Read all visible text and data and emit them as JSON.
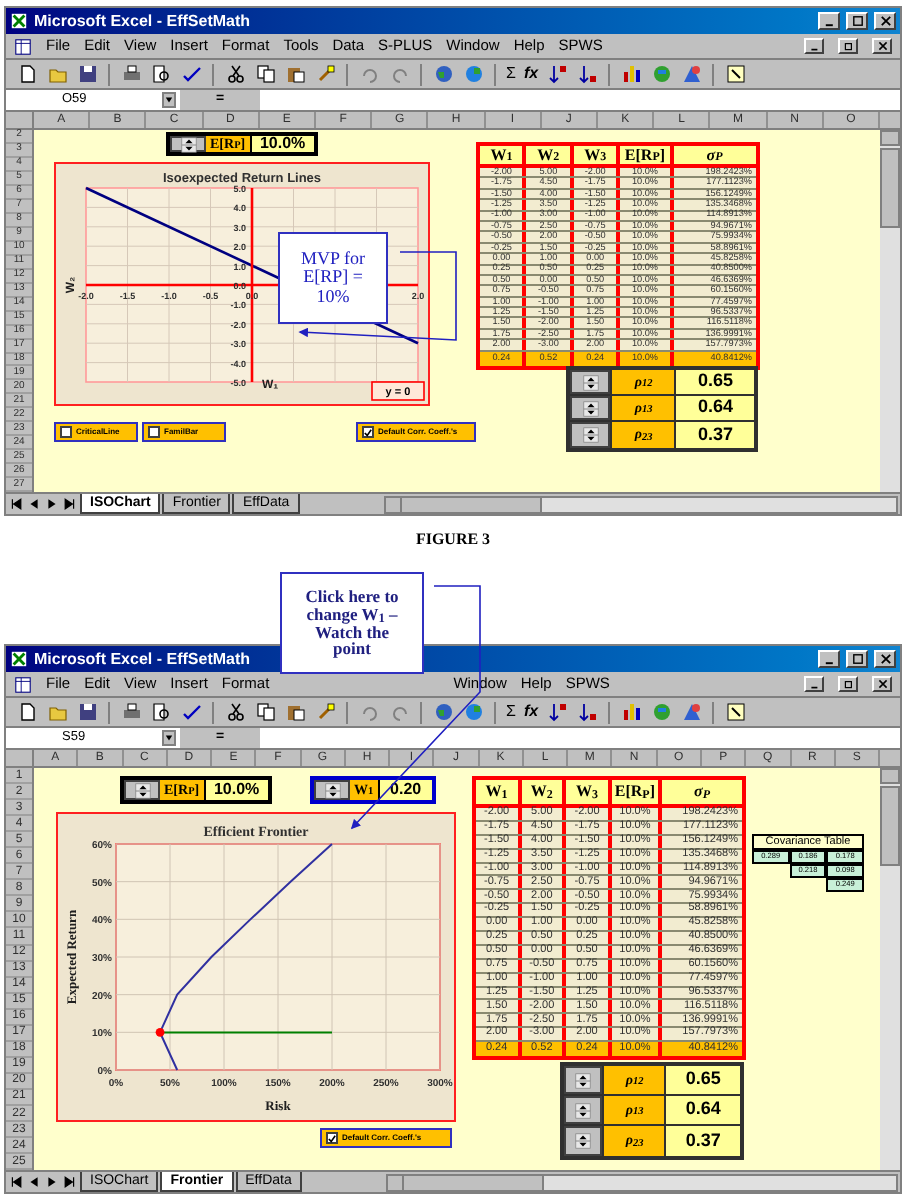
{
  "figures": [
    {
      "window": {
        "title": "Microsoft Excel - EffSetMath"
      },
      "menu": [
        "File",
        "Edit",
        "View",
        "Insert",
        "Format",
        "Tools",
        "Data",
        "S-PLUS",
        "Window",
        "Help",
        "SPWS"
      ],
      "toolbar": {
        "sum_glyph": "Σ",
        "function_glyph": "fx"
      },
      "name_box": "O59",
      "formula_sign": "=",
      "columns": [
        "A",
        "B",
        "C",
        "D",
        "E",
        "F",
        "G",
        "H",
        "I",
        "J",
        "K",
        "L",
        "M",
        "N",
        "O"
      ],
      "rows": [
        "2",
        "3",
        "4",
        "5",
        "6",
        "7",
        "8",
        "9",
        "10",
        "11",
        "12",
        "13",
        "14",
        "15",
        "16",
        "17",
        "18",
        "19",
        "20",
        "21",
        "22",
        "23",
        "24",
        "25",
        "26",
        "27"
      ],
      "spinners": [
        {
          "label": "E[R$_{P}$]",
          "value": "10.0%",
          "color": "#000000"
        }
      ],
      "chart": {
        "chart_data": {
          "type": "line",
          "title": "Isoexpected Return Lines",
          "xlabel": "W₁",
          "ylabel": "W₂",
          "x": [
            -2,
            0,
            0,
            2
          ],
          "xlim": [
            -2,
            2
          ],
          "ylim": [
            -5,
            5
          ],
          "grid": true,
          "series": [
            {
              "color": "#000080",
              "values": [
                5,
                null,
                null,
                -3
              ]
            },
            {
              "name": "y = 0",
              "color": "#ff0000",
              "values": [
                0,
                null,
                null,
                0
              ]
            },
            {
              "color": "#ff0000",
              "values": [
                null,
                5,
                -5,
                null
              ]
            }
          ],
          "xticks": [
            {
              "value": -2,
              "label": "-2.0"
            },
            {
              "value": -1.5,
              "label": "-1.5"
            },
            {
              "value": -1,
              "label": "-1.0"
            },
            {
              "value": -0.5,
              "label": "-0.5"
            },
            {
              "value": 0,
              "label": "0.0"
            },
            {
              "value": 2,
              "label": "2.0"
            }
          ],
          "yticks": [
            {
              "value": 5,
              "label": "5.0"
            },
            {
              "value": 4,
              "label": "4.0"
            },
            {
              "value": 3,
              "label": "3.0"
            },
            {
              "value": 2,
              "label": "2.0"
            },
            {
              "value": 1,
              "label": "1.0"
            },
            {
              "value": 0,
              "label": "0.0"
            },
            {
              "value": -1,
              "label": "-1.0"
            },
            {
              "value": -2,
              "label": "-2.0"
            },
            {
              "value": -3,
              "label": "-3.0"
            },
            {
              "value": -4,
              "label": "-4.0"
            },
            {
              "value": -5,
              "label": "-5.0"
            }
          ]
        }
      },
      "checkboxes": [
        {
          "label": "CriticalLine",
          "checked": false
        },
        {
          "label": "FamilBar",
          "checked": false
        },
        {
          "label": "Default Corr. Coeff.'s",
          "checked": true
        }
      ],
      "table": {
        "columns": [
          "W$_{1}$",
          "W$_{2}$",
          "W$_{3}$",
          "E[R$_{P}$]",
          "σ$_{P}$"
        ],
        "rows": [
          {
            "kind": "data",
            "cells": [
              "-2.00",
              "5.00",
              "-2.00",
              "10.0%",
              "198.2423%"
            ]
          },
          {
            "kind": "data",
            "cells": [
              "-1.75",
              "4.50",
              "-1.75",
              "10.0%",
              "177.1123%"
            ]
          },
          {
            "kind": "data",
            "cells": [
              "-1.50",
              "4.00",
              "-1.50",
              "10.0%",
              "156.1249%"
            ]
          },
          {
            "kind": "data",
            "cells": [
              "-1.25",
              "3.50",
              "-1.25",
              "10.0%",
              "135.3468%"
            ]
          },
          {
            "kind": "data",
            "cells": [
              "-1.00",
              "3.00",
              "-1.00",
              "10.0%",
              "114.8913%"
            ]
          },
          {
            "kind": "data",
            "cells": [
              "-0.75",
              "2.50",
              "-0.75",
              "10.0%",
              "94.9671%"
            ]
          },
          {
            "kind": "data",
            "cells": [
              "-0.50",
              "2.00",
              "-0.50",
              "10.0%",
              "75.9934%"
            ]
          },
          {
            "kind": "data",
            "cells": [
              "-0.25",
              "1.50",
              "-0.25",
              "10.0%",
              "58.8961%"
            ]
          },
          {
            "kind": "data",
            "cells": [
              "0.00",
              "1.00",
              "0.00",
              "10.0%",
              "45.8258%"
            ]
          },
          {
            "kind": "data",
            "cells": [
              "0.25",
              "0.50",
              "0.25",
              "10.0%",
              "40.8500%"
            ]
          },
          {
            "kind": "data",
            "cells": [
              "0.50",
              "0.00",
              "0.50",
              "10.0%",
              "46.6369%"
            ]
          },
          {
            "kind": "data",
            "cells": [
              "0.75",
              "-0.50",
              "0.75",
              "10.0%",
              "60.1560%"
            ]
          },
          {
            "kind": "data",
            "cells": [
              "1.00",
              "-1.00",
              "1.00",
              "10.0%",
              "77.4597%"
            ]
          },
          {
            "kind": "data",
            "cells": [
              "1.25",
              "-1.50",
              "1.25",
              "10.0%",
              "96.5337%"
            ]
          },
          {
            "kind": "data",
            "cells": [
              "1.50",
              "-2.00",
              "1.50",
              "10.0%",
              "116.5118%"
            ]
          },
          {
            "kind": "data",
            "cells": [
              "1.75",
              "-2.50",
              "1.75",
              "10.0%",
              "136.9991%"
            ]
          },
          {
            "kind": "data",
            "cells": [
              "2.00",
              "-3.00",
              "2.00",
              "10.0%",
              "157.7973%"
            ]
          },
          {
            "kind": "result",
            "cells": [
              "0.24",
              "0.52",
              "0.24",
              "10.0%",
              "40.8412%"
            ]
          }
        ]
      },
      "correlations": [
        {
          "label": "ρ$_{12}$",
          "value": "0.65"
        },
        {
          "label": "ρ$_{13}$",
          "value": "0.64"
        },
        {
          "label": "ρ$_{23}$",
          "value": "0.37"
        }
      ],
      "sheet_tabs": [
        {
          "label": "ISOChart",
          "selected": true
        },
        {
          "label": "Frontier",
          "selected": false
        },
        {
          "label": "EffData",
          "selected": false
        }
      ],
      "callout": {
        "lines": [
          "MVP for",
          "E[RP] =",
          "10%"
        ]
      }
    },
    {
      "window": {
        "title": "Microsoft Excel - EffSetMath"
      },
      "menu": [
        "File",
        "Edit",
        "View",
        "Insert",
        "Format",
        "Window",
        "Help",
        "SPWS"
      ],
      "toolbar": {
        "sum_glyph": "Σ",
        "function_glyph": "fx"
      },
      "name_box": "S59",
      "formula_sign": "=",
      "columns": [
        "A",
        "B",
        "C",
        "D",
        "E",
        "F",
        "G",
        "H",
        "I",
        "J",
        "K",
        "L",
        "M",
        "N",
        "O",
        "P",
        "Q",
        "R",
        "S"
      ],
      "rows": [
        "1",
        "2",
        "3",
        "4",
        "5",
        "6",
        "7",
        "8",
        "9",
        "10",
        "11",
        "12",
        "13",
        "14",
        "15",
        "16",
        "17",
        "18",
        "19",
        "20",
        "21",
        "22",
        "23",
        "24",
        "25"
      ],
      "spinners": [
        {
          "label": "E[R$_{P}$]",
          "value": "10.0%",
          "color": "#000000"
        },
        {
          "label": "W$_{1}$",
          "value": "0.20",
          "color": "#0000cc"
        }
      ],
      "chart": {
        "chart_data": {
          "type": "line",
          "title": "Efficient Frontier",
          "xlabel": "Risk",
          "ylabel": "Expected Return",
          "x": [
            56.6,
            40.8,
            56.6,
            88.3,
            124.4,
            161.9,
            200,
            200
          ],
          "xlim": [
            0,
            300
          ],
          "ylim": [
            0,
            60
          ],
          "grid": true,
          "series": [
            {
              "color": "#3030a0",
              "values": [
                0,
                10,
                20,
                30,
                40,
                50,
                60,
                null
              ]
            },
            {
              "color": "#008000",
              "values": [
                null,
                10,
                null,
                null,
                null,
                null,
                null,
                10
              ]
            },
            {
              "color": "#ff0000",
              "marker": true,
              "values": [
                null,
                10,
                null,
                null,
                null,
                null,
                null,
                null
              ]
            }
          ],
          "xticks": [
            {
              "value": 0,
              "label": "0%"
            },
            {
              "value": 50,
              "label": "50%"
            },
            {
              "value": 100,
              "label": "100%"
            },
            {
              "value": 150,
              "label": "150%"
            },
            {
              "value": 200,
              "label": "200%"
            },
            {
              "value": 250,
              "label": "250%"
            },
            {
              "value": 300,
              "label": "300%"
            }
          ],
          "yticks": [
            {
              "value": 0,
              "label": "0%"
            },
            {
              "value": 10,
              "label": "10%"
            },
            {
              "value": 20,
              "label": "20%"
            },
            {
              "value": 30,
              "label": "30%"
            },
            {
              "value": 40,
              "label": "40%"
            },
            {
              "value": 50,
              "label": "50%"
            },
            {
              "value": 60,
              "label": "60%"
            }
          ]
        }
      },
      "checkboxes": [
        {
          "label": "Default Corr. Coeff.'s",
          "checked": true
        }
      ],
      "table": {
        "columns": [
          "W$_{1}$",
          "W$_{2}$",
          "W$_{3}$",
          "E[R$_{P}$]",
          "σ$_{P}$"
        ],
        "rows": [
          {
            "kind": "data",
            "cells": [
              "-2.00",
              "5.00",
              "-2.00",
              "10.0%",
              "198.2423%"
            ]
          },
          {
            "kind": "data",
            "cells": [
              "-1.75",
              "4.50",
              "-1.75",
              "10.0%",
              "177.1123%"
            ]
          },
          {
            "kind": "data",
            "cells": [
              "-1.50",
              "4.00",
              "-1.50",
              "10.0%",
              "156.1249%"
            ]
          },
          {
            "kind": "data",
            "cells": [
              "-1.25",
              "3.50",
              "-1.25",
              "10.0%",
              "135.3468%"
            ]
          },
          {
            "kind": "data",
            "cells": [
              "-1.00",
              "3.00",
              "-1.00",
              "10.0%",
              "114.8913%"
            ]
          },
          {
            "kind": "data",
            "cells": [
              "-0.75",
              "2.50",
              "-0.75",
              "10.0%",
              "94.9671%"
            ]
          },
          {
            "kind": "data",
            "cells": [
              "-0.50",
              "2.00",
              "-0.50",
              "10.0%",
              "75.9934%"
            ]
          },
          {
            "kind": "data",
            "cells": [
              "-0.25",
              "1.50",
              "-0.25",
              "10.0%",
              "58.8961%"
            ]
          },
          {
            "kind": "data",
            "cells": [
              "0.00",
              "1.00",
              "0.00",
              "10.0%",
              "45.8258%"
            ]
          },
          {
            "kind": "data",
            "cells": [
              "0.25",
              "0.50",
              "0.25",
              "10.0%",
              "40.8500%"
            ]
          },
          {
            "kind": "data",
            "cells": [
              "0.50",
              "0.00",
              "0.50",
              "10.0%",
              "46.6369%"
            ]
          },
          {
            "kind": "data",
            "cells": [
              "0.75",
              "-0.50",
              "0.75",
              "10.0%",
              "60.1560%"
            ]
          },
          {
            "kind": "data",
            "cells": [
              "1.00",
              "-1.00",
              "1.00",
              "10.0%",
              "77.4597%"
            ]
          },
          {
            "kind": "data",
            "cells": [
              "1.25",
              "-1.50",
              "1.25",
              "10.0%",
              "96.5337%"
            ]
          },
          {
            "kind": "data",
            "cells": [
              "1.50",
              "-2.00",
              "1.50",
              "10.0%",
              "116.5118%"
            ]
          },
          {
            "kind": "data",
            "cells": [
              "1.75",
              "-2.50",
              "1.75",
              "10.0%",
              "136.9991%"
            ]
          },
          {
            "kind": "data",
            "cells": [
              "2.00",
              "-3.00",
              "2.00",
              "10.0%",
              "157.7973%"
            ]
          },
          {
            "kind": "result",
            "cells": [
              "0.24",
              "0.52",
              "0.24",
              "10.0%",
              "40.8412%"
            ]
          }
        ]
      },
      "covariance": {
        "title": "Covariance Table",
        "rows": [
          [
            "0.289",
            "0.186",
            "0.178"
          ],
          [
            "",
            "0.218",
            "0.098"
          ],
          [
            "",
            "",
            "0.249"
          ]
        ]
      },
      "correlations": [
        {
          "label": "ρ$_{12}$",
          "value": "0.65"
        },
        {
          "label": "ρ$_{13}$",
          "value": "0.64"
        },
        {
          "label": "ρ$_{23}$",
          "value": "0.37"
        }
      ],
      "sheet_tabs": [
        {
          "label": "ISOChart",
          "selected": false
        },
        {
          "label": "Frontier",
          "selected": true
        },
        {
          "label": "EffData",
          "selected": false
        }
      ]
    }
  ],
  "caption": "FIGURE 3",
  "annotation_callout": {
    "lines": [
      "Click here to",
      "change W$_{1}$ –",
      "Watch the",
      "point"
    ]
  }
}
